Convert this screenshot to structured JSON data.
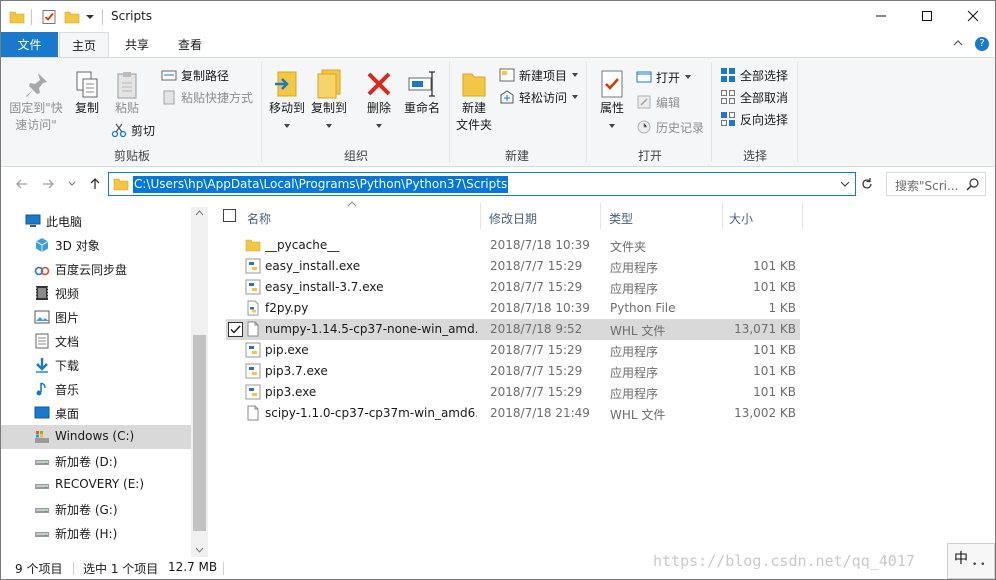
{
  "window": {
    "title": "Scripts",
    "minimize": "minimize",
    "maximize": "maximize",
    "close": "close"
  },
  "ribbon_tabs": [
    "文件",
    "主页",
    "共享",
    "查看"
  ],
  "ribbon": {
    "clipboard": {
      "pin_label_1": "固定到\"快",
      "pin_label_2": "速访问\"",
      "copy": "复制",
      "paste": "粘贴",
      "copy_path": "复制路径",
      "paste_shortcut": "粘贴快捷方式",
      "cut": "剪切",
      "group": "剪贴板"
    },
    "organize": {
      "move_to": "移动到",
      "copy_to": "复制到",
      "delete": "删除",
      "rename": "重命名",
      "group": "组织"
    },
    "new": {
      "new_folder_1": "新建",
      "new_folder_2": "文件夹",
      "new_item": "新建项目",
      "easy_access": "轻松访问",
      "group": "新建"
    },
    "open": {
      "properties": "属性",
      "open": "打开",
      "edit": "编辑",
      "history": "历史记录",
      "group": "打开"
    },
    "select": {
      "select_all": "全部选择",
      "select_none": "全部取消",
      "invert": "反向选择",
      "group": "选择"
    }
  },
  "address": {
    "path": "C:\\Users\\hp\\AppData\\Local\\Programs\\Python\\Python37\\Scripts",
    "search_placeholder": "搜索\"Scri..."
  },
  "nav": [
    {
      "label": "此电脑",
      "icon": "computer-icon"
    },
    {
      "label": "3D 对象",
      "icon": "3d-objects-icon"
    },
    {
      "label": "百度云同步盘",
      "icon": "baidu-cloud-icon"
    },
    {
      "label": "视频",
      "icon": "video-icon"
    },
    {
      "label": "图片",
      "icon": "pictures-icon"
    },
    {
      "label": "文档",
      "icon": "documents-icon"
    },
    {
      "label": "下载",
      "icon": "download-icon"
    },
    {
      "label": "音乐",
      "icon": "music-icon"
    },
    {
      "label": "桌面",
      "icon": "desktop-icon"
    },
    {
      "label": "Windows (C:)",
      "icon": "drive-c-icon"
    },
    {
      "label": "新加卷 (D:)",
      "icon": "drive-icon"
    },
    {
      "label": "RECOVERY (E:)",
      "icon": "drive-icon"
    },
    {
      "label": "新加卷 (G:)",
      "icon": "drive-icon"
    },
    {
      "label": "新加卷 (H:)",
      "icon": "drive-icon"
    }
  ],
  "columns": {
    "name": "名称",
    "modified": "修改日期",
    "type": "类型",
    "size": "大小"
  },
  "files": [
    {
      "name": "__pycache__",
      "modified": "2018/7/18 10:39",
      "type": "文件夹",
      "size": "",
      "icon": "folder-icon"
    },
    {
      "name": "easy_install.exe",
      "modified": "2018/7/7 15:29",
      "type": "应用程序",
      "size": "101 KB",
      "icon": "python-exe-icon"
    },
    {
      "name": "easy_install-3.7.exe",
      "modified": "2018/7/7 15:29",
      "type": "应用程序",
      "size": "101 KB",
      "icon": "python-exe-icon"
    },
    {
      "name": "f2py.py",
      "modified": "2018/7/18 10:39",
      "type": "Python File",
      "size": "1 KB",
      "icon": "python-file-icon"
    },
    {
      "name": "numpy-1.14.5-cp37-none-win_amd...",
      "modified": "2018/7/18 9:52",
      "type": "WHL 文件",
      "size": "13,071 KB",
      "icon": "blank-file-icon"
    },
    {
      "name": "pip.exe",
      "modified": "2018/7/7 15:29",
      "type": "应用程序",
      "size": "101 KB",
      "icon": "python-exe-icon"
    },
    {
      "name": "pip3.7.exe",
      "modified": "2018/7/7 15:29",
      "type": "应用程序",
      "size": "101 KB",
      "icon": "python-exe-icon"
    },
    {
      "name": "pip3.exe",
      "modified": "2018/7/7 15:29",
      "type": "应用程序",
      "size": "101 KB",
      "icon": "python-exe-icon"
    },
    {
      "name": "scipy-1.1.0-cp37-cp37m-win_amd6...",
      "modified": "2018/7/18 21:49",
      "type": "WHL 文件",
      "size": "13,002 KB",
      "icon": "blank-file-icon"
    }
  ],
  "status": {
    "count": "9 个项目",
    "selected": "选中 1 个项目",
    "size": "12.7 MB"
  },
  "watermark": "https://blog.csdn.net/qq_4017",
  "ime": {
    "mode": "中",
    "extra": "• •"
  },
  "colors": {
    "accent": "#1979ca",
    "selection": "#d9d9d9",
    "address_highlight": "#0078d7",
    "folder": "#f3c744"
  }
}
